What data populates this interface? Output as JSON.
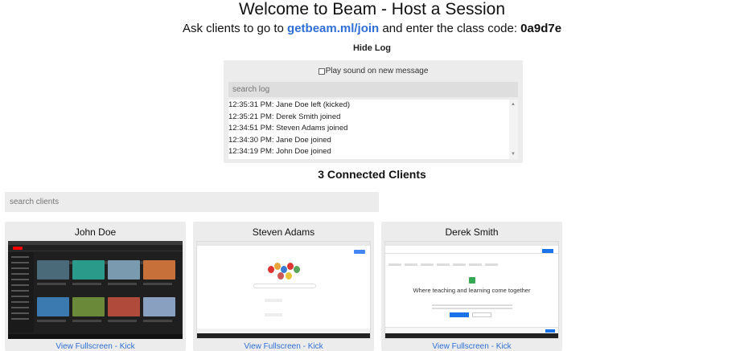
{
  "header": {
    "title": "Welcome to Beam - Host a Session",
    "subtitle_prefix": "Ask clients to go to",
    "join_link": "getbeam.ml/join",
    "subtitle_middle": "and enter the class code:",
    "class_code": "0a9d7e"
  },
  "log": {
    "toggle_label": "Hide Log",
    "sound_label": "Play sound on new message",
    "sound_checked": false,
    "search_placeholder": "search log",
    "entries": [
      "12:35:31 PM: Jane Doe left (kicked)",
      "12:35:21 PM: Derek Smith joined",
      "12:34:51 PM: Steven Adams joined",
      "12:34:30 PM: Jane Doe joined",
      "12:34:19 PM: John Doe joined"
    ]
  },
  "clients": {
    "heading": "3 Connected Clients",
    "search_placeholder": "search clients",
    "list": [
      {
        "name": "John Doe",
        "fullscreen_label": "View Fullscreen",
        "separator": " - ",
        "kick_label": "Kick",
        "screen": "youtube"
      },
      {
        "name": "Steven Adams",
        "fullscreen_label": "View Fullscreen",
        "separator": " - ",
        "kick_label": "Kick",
        "screen": "google"
      },
      {
        "name": "Derek Smith",
        "fullscreen_label": "View Fullscreen",
        "separator": " - ",
        "kick_label": "Kick",
        "screen": "classroom",
        "screen_text": "Where teaching and learning come together"
      }
    ]
  },
  "colors": {
    "link": "#2f6fd6",
    "panel": "#ececec"
  }
}
